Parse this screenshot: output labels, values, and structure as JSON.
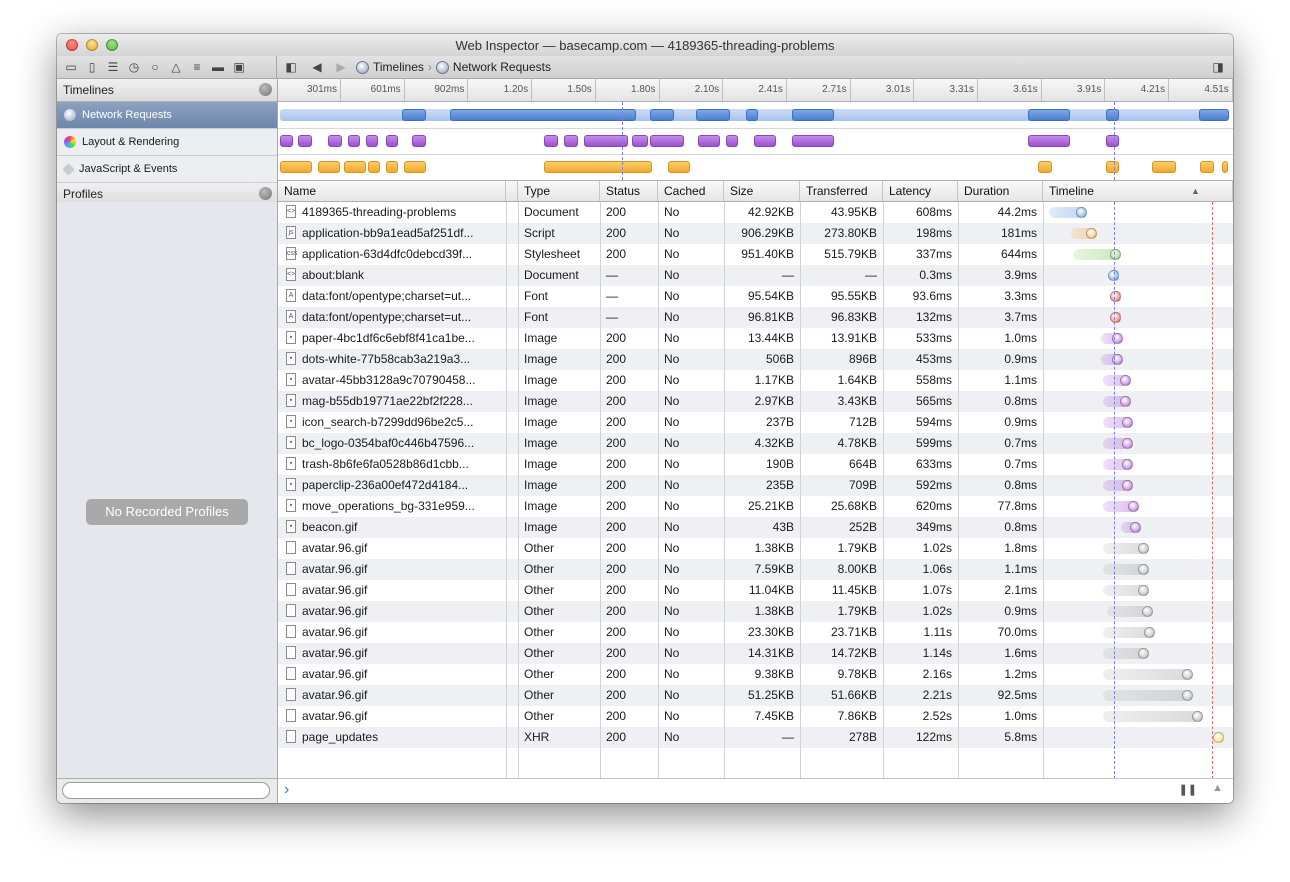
{
  "window": {
    "title": "Web Inspector — basecamp.com — 4189365-threading-problems"
  },
  "toolbar": {
    "icons": [
      "panel-icon",
      "document-icon",
      "database-icon",
      "timeline-icon",
      "search-icon",
      "warning-icon",
      "list-icon",
      "tag-icon",
      "console-icon"
    ],
    "breadcrumb": {
      "first": "Timelines",
      "second": "Network Requests"
    }
  },
  "sidebar": {
    "timelines_header": "Timelines",
    "items": [
      {
        "label": "Network Requests",
        "selected": true
      },
      {
        "label": "Layout & Rendering",
        "selected": false
      },
      {
        "label": "JavaScript & Events",
        "selected": false
      }
    ],
    "profiles_header": "Profiles",
    "no_profiles": "No Recorded Profiles",
    "search_placeholder": ""
  },
  "ruler": {
    "ticks": [
      "301ms",
      "601ms",
      "902ms",
      "1.20s",
      "1.50s",
      "1.80s",
      "2.10s",
      "2.41s",
      "2.71s",
      "3.01s",
      "3.31s",
      "3.61s",
      "3.91s",
      "4.21s",
      "4.51s"
    ]
  },
  "columns": [
    "Name",
    "Type",
    "Status",
    "Cached",
    "Size",
    "Transferred",
    "Latency",
    "Duration",
    "Timeline"
  ],
  "requests": [
    {
      "name": "4189365-threading-problems",
      "type": "Document",
      "status": "200",
      "cached": "No",
      "size": "42.92KB",
      "transferred": "43.95KB",
      "latency": "608ms",
      "duration": "44.2ms",
      "icon": "document",
      "color": "#6fa0e8"
    },
    {
      "name": "application-bb9a1ead5af251df...",
      "type": "Script",
      "status": "200",
      "cached": "No",
      "size": "906.29KB",
      "transferred": "273.80KB",
      "latency": "198ms",
      "duration": "181ms",
      "icon": "script",
      "color": "#f2b25a"
    },
    {
      "name": "application-63d4dfc0debcd39f...",
      "type": "Stylesheet",
      "status": "200",
      "cached": "No",
      "size": "951.40KB",
      "transferred": "515.79KB",
      "latency": "337ms",
      "duration": "644ms",
      "icon": "stylesheet",
      "color": "#8ad16a"
    },
    {
      "name": "about:blank",
      "type": "Document",
      "status": "—",
      "cached": "No",
      "size": "—",
      "transferred": "—",
      "latency": "0.3ms",
      "duration": "3.9ms",
      "icon": "document",
      "color": "#6fa0e8"
    },
    {
      "name": "data:font/opentype;charset=ut...",
      "type": "Font",
      "status": "—",
      "cached": "No",
      "size": "95.54KB",
      "transferred": "95.55KB",
      "latency": "93.6ms",
      "duration": "3.3ms",
      "icon": "font",
      "color": "#e86a5e"
    },
    {
      "name": "data:font/opentype;charset=ut...",
      "type": "Font",
      "status": "—",
      "cached": "No",
      "size": "96.81KB",
      "transferred": "96.83KB",
      "latency": "132ms",
      "duration": "3.7ms",
      "icon": "font",
      "color": "#e86a5e"
    },
    {
      "name": "paper-4bc1df6c6ebf8f41ca1be...",
      "type": "Image",
      "status": "200",
      "cached": "No",
      "size": "13.44KB",
      "transferred": "13.91KB",
      "latency": "533ms",
      "duration": "1.0ms",
      "icon": "image",
      "color": "#b06ad8"
    },
    {
      "name": "dots-white-77b58cab3a219a3...",
      "type": "Image",
      "status": "200",
      "cached": "No",
      "size": "506B",
      "transferred": "896B",
      "latency": "453ms",
      "duration": "0.9ms",
      "icon": "image",
      "color": "#b06ad8"
    },
    {
      "name": "avatar-45bb3128a9c70790458...",
      "type": "Image",
      "status": "200",
      "cached": "No",
      "size": "1.17KB",
      "transferred": "1.64KB",
      "latency": "558ms",
      "duration": "1.1ms",
      "icon": "image",
      "color": "#b06ad8"
    },
    {
      "name": "mag-b55db19771ae22bf2f228...",
      "type": "Image",
      "status": "200",
      "cached": "No",
      "size": "2.97KB",
      "transferred": "3.43KB",
      "latency": "565ms",
      "duration": "0.8ms",
      "icon": "image",
      "color": "#b06ad8"
    },
    {
      "name": "icon_search-b7299dd96be2c5...",
      "type": "Image",
      "status": "200",
      "cached": "No",
      "size": "237B",
      "transferred": "712B",
      "latency": "594ms",
      "duration": "0.9ms",
      "icon": "image",
      "color": "#b06ad8"
    },
    {
      "name": "bc_logo-0354baf0c446b47596...",
      "type": "Image",
      "status": "200",
      "cached": "No",
      "size": "4.32KB",
      "transferred": "4.78KB",
      "latency": "599ms",
      "duration": "0.7ms",
      "icon": "image",
      "color": "#b06ad8"
    },
    {
      "name": "trash-8b6fe6fa0528b86d1cbb...",
      "type": "Image",
      "status": "200",
      "cached": "No",
      "size": "190B",
      "transferred": "664B",
      "latency": "633ms",
      "duration": "0.7ms",
      "icon": "image",
      "color": "#b06ad8"
    },
    {
      "name": "paperclip-236a00ef472d4184...",
      "type": "Image",
      "status": "200",
      "cached": "No",
      "size": "235B",
      "transferred": "709B",
      "latency": "592ms",
      "duration": "0.8ms",
      "icon": "image",
      "color": "#b06ad8"
    },
    {
      "name": "move_operations_bg-331e959...",
      "type": "Image",
      "status": "200",
      "cached": "No",
      "size": "25.21KB",
      "transferred": "25.68KB",
      "latency": "620ms",
      "duration": "77.8ms",
      "icon": "image",
      "color": "#b06ad8"
    },
    {
      "name": "beacon.gif",
      "type": "Image",
      "status": "200",
      "cached": "No",
      "size": "43B",
      "transferred": "252B",
      "latency": "349ms",
      "duration": "0.8ms",
      "icon": "image",
      "color": "#b06ad8"
    },
    {
      "name": "avatar.96.gif",
      "type": "Other",
      "status": "200",
      "cached": "No",
      "size": "1.38KB",
      "transferred": "1.79KB",
      "latency": "1.02s",
      "duration": "1.8ms",
      "icon": "other",
      "color": "#b0b0b0"
    },
    {
      "name": "avatar.96.gif",
      "type": "Other",
      "status": "200",
      "cached": "No",
      "size": "7.59KB",
      "transferred": "8.00KB",
      "latency": "1.06s",
      "duration": "1.1ms",
      "icon": "other",
      "color": "#b0b0b0"
    },
    {
      "name": "avatar.96.gif",
      "type": "Other",
      "status": "200",
      "cached": "No",
      "size": "11.04KB",
      "transferred": "11.45KB",
      "latency": "1.07s",
      "duration": "2.1ms",
      "icon": "other",
      "color": "#b0b0b0"
    },
    {
      "name": "avatar.96.gif",
      "type": "Other",
      "status": "200",
      "cached": "No",
      "size": "1.38KB",
      "transferred": "1.79KB",
      "latency": "1.02s",
      "duration": "0.9ms",
      "icon": "other",
      "color": "#b0b0b0"
    },
    {
      "name": "avatar.96.gif",
      "type": "Other",
      "status": "200",
      "cached": "No",
      "size": "23.30KB",
      "transferred": "23.71KB",
      "latency": "1.11s",
      "duration": "70.0ms",
      "icon": "other",
      "color": "#b0b0b0"
    },
    {
      "name": "avatar.96.gif",
      "type": "Other",
      "status": "200",
      "cached": "No",
      "size": "14.31KB",
      "transferred": "14.72KB",
      "latency": "1.14s",
      "duration": "1.6ms",
      "icon": "other",
      "color": "#b0b0b0"
    },
    {
      "name": "avatar.96.gif",
      "type": "Other",
      "status": "200",
      "cached": "No",
      "size": "9.38KB",
      "transferred": "9.78KB",
      "latency": "2.16s",
      "duration": "1.2ms",
      "icon": "other",
      "color": "#b0b0b0"
    },
    {
      "name": "avatar.96.gif",
      "type": "Other",
      "status": "200",
      "cached": "No",
      "size": "51.25KB",
      "transferred": "51.66KB",
      "latency": "2.21s",
      "duration": "92.5ms",
      "icon": "other",
      "color": "#b0b0b0"
    },
    {
      "name": "avatar.96.gif",
      "type": "Other",
      "status": "200",
      "cached": "No",
      "size": "7.45KB",
      "transferred": "7.86KB",
      "latency": "2.52s",
      "duration": "1.0ms",
      "icon": "other",
      "color": "#b0b0b0"
    },
    {
      "name": "page_updates",
      "type": "XHR",
      "status": "200",
      "cached": "No",
      "size": "—",
      "transferred": "278B",
      "latency": "122ms",
      "duration": "5.8ms",
      "icon": "other",
      "color": "#f0e060"
    }
  ],
  "console": {
    "prompt": "›"
  }
}
